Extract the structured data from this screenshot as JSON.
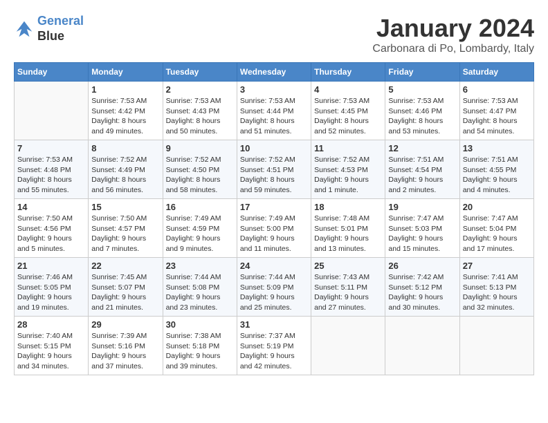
{
  "logo": {
    "line1": "General",
    "line2": "Blue"
  },
  "title": "January 2024",
  "location": "Carbonara di Po, Lombardy, Italy",
  "days_of_week": [
    "Sunday",
    "Monday",
    "Tuesday",
    "Wednesday",
    "Thursday",
    "Friday",
    "Saturday"
  ],
  "weeks": [
    [
      {
        "day": "",
        "sunrise": "",
        "sunset": "",
        "daylight": ""
      },
      {
        "day": "1",
        "sunrise": "Sunrise: 7:53 AM",
        "sunset": "Sunset: 4:42 PM",
        "daylight": "Daylight: 8 hours and 49 minutes."
      },
      {
        "day": "2",
        "sunrise": "Sunrise: 7:53 AM",
        "sunset": "Sunset: 4:43 PM",
        "daylight": "Daylight: 8 hours and 50 minutes."
      },
      {
        "day": "3",
        "sunrise": "Sunrise: 7:53 AM",
        "sunset": "Sunset: 4:44 PM",
        "daylight": "Daylight: 8 hours and 51 minutes."
      },
      {
        "day": "4",
        "sunrise": "Sunrise: 7:53 AM",
        "sunset": "Sunset: 4:45 PM",
        "daylight": "Daylight: 8 hours and 52 minutes."
      },
      {
        "day": "5",
        "sunrise": "Sunrise: 7:53 AM",
        "sunset": "Sunset: 4:46 PM",
        "daylight": "Daylight: 8 hours and 53 minutes."
      },
      {
        "day": "6",
        "sunrise": "Sunrise: 7:53 AM",
        "sunset": "Sunset: 4:47 PM",
        "daylight": "Daylight: 8 hours and 54 minutes."
      }
    ],
    [
      {
        "day": "7",
        "sunrise": "Sunrise: 7:53 AM",
        "sunset": "Sunset: 4:48 PM",
        "daylight": "Daylight: 8 hours and 55 minutes."
      },
      {
        "day": "8",
        "sunrise": "Sunrise: 7:52 AM",
        "sunset": "Sunset: 4:49 PM",
        "daylight": "Daylight: 8 hours and 56 minutes."
      },
      {
        "day": "9",
        "sunrise": "Sunrise: 7:52 AM",
        "sunset": "Sunset: 4:50 PM",
        "daylight": "Daylight: 8 hours and 58 minutes."
      },
      {
        "day": "10",
        "sunrise": "Sunrise: 7:52 AM",
        "sunset": "Sunset: 4:51 PM",
        "daylight": "Daylight: 8 hours and 59 minutes."
      },
      {
        "day": "11",
        "sunrise": "Sunrise: 7:52 AM",
        "sunset": "Sunset: 4:53 PM",
        "daylight": "Daylight: 9 hours and 1 minute."
      },
      {
        "day": "12",
        "sunrise": "Sunrise: 7:51 AM",
        "sunset": "Sunset: 4:54 PM",
        "daylight": "Daylight: 9 hours and 2 minutes."
      },
      {
        "day": "13",
        "sunrise": "Sunrise: 7:51 AM",
        "sunset": "Sunset: 4:55 PM",
        "daylight": "Daylight: 9 hours and 4 minutes."
      }
    ],
    [
      {
        "day": "14",
        "sunrise": "Sunrise: 7:50 AM",
        "sunset": "Sunset: 4:56 PM",
        "daylight": "Daylight: 9 hours and 5 minutes."
      },
      {
        "day": "15",
        "sunrise": "Sunrise: 7:50 AM",
        "sunset": "Sunset: 4:57 PM",
        "daylight": "Daylight: 9 hours and 7 minutes."
      },
      {
        "day": "16",
        "sunrise": "Sunrise: 7:49 AM",
        "sunset": "Sunset: 4:59 PM",
        "daylight": "Daylight: 9 hours and 9 minutes."
      },
      {
        "day": "17",
        "sunrise": "Sunrise: 7:49 AM",
        "sunset": "Sunset: 5:00 PM",
        "daylight": "Daylight: 9 hours and 11 minutes."
      },
      {
        "day": "18",
        "sunrise": "Sunrise: 7:48 AM",
        "sunset": "Sunset: 5:01 PM",
        "daylight": "Daylight: 9 hours and 13 minutes."
      },
      {
        "day": "19",
        "sunrise": "Sunrise: 7:47 AM",
        "sunset": "Sunset: 5:03 PM",
        "daylight": "Daylight: 9 hours and 15 minutes."
      },
      {
        "day": "20",
        "sunrise": "Sunrise: 7:47 AM",
        "sunset": "Sunset: 5:04 PM",
        "daylight": "Daylight: 9 hours and 17 minutes."
      }
    ],
    [
      {
        "day": "21",
        "sunrise": "Sunrise: 7:46 AM",
        "sunset": "Sunset: 5:05 PM",
        "daylight": "Daylight: 9 hours and 19 minutes."
      },
      {
        "day": "22",
        "sunrise": "Sunrise: 7:45 AM",
        "sunset": "Sunset: 5:07 PM",
        "daylight": "Daylight: 9 hours and 21 minutes."
      },
      {
        "day": "23",
        "sunrise": "Sunrise: 7:44 AM",
        "sunset": "Sunset: 5:08 PM",
        "daylight": "Daylight: 9 hours and 23 minutes."
      },
      {
        "day": "24",
        "sunrise": "Sunrise: 7:44 AM",
        "sunset": "Sunset: 5:09 PM",
        "daylight": "Daylight: 9 hours and 25 minutes."
      },
      {
        "day": "25",
        "sunrise": "Sunrise: 7:43 AM",
        "sunset": "Sunset: 5:11 PM",
        "daylight": "Daylight: 9 hours and 27 minutes."
      },
      {
        "day": "26",
        "sunrise": "Sunrise: 7:42 AM",
        "sunset": "Sunset: 5:12 PM",
        "daylight": "Daylight: 9 hours and 30 minutes."
      },
      {
        "day": "27",
        "sunrise": "Sunrise: 7:41 AM",
        "sunset": "Sunset: 5:13 PM",
        "daylight": "Daylight: 9 hours and 32 minutes."
      }
    ],
    [
      {
        "day": "28",
        "sunrise": "Sunrise: 7:40 AM",
        "sunset": "Sunset: 5:15 PM",
        "daylight": "Daylight: 9 hours and 34 minutes."
      },
      {
        "day": "29",
        "sunrise": "Sunrise: 7:39 AM",
        "sunset": "Sunset: 5:16 PM",
        "daylight": "Daylight: 9 hours and 37 minutes."
      },
      {
        "day": "30",
        "sunrise": "Sunrise: 7:38 AM",
        "sunset": "Sunset: 5:18 PM",
        "daylight": "Daylight: 9 hours and 39 minutes."
      },
      {
        "day": "31",
        "sunrise": "Sunrise: 7:37 AM",
        "sunset": "Sunset: 5:19 PM",
        "daylight": "Daylight: 9 hours and 42 minutes."
      },
      {
        "day": "",
        "sunrise": "",
        "sunset": "",
        "daylight": ""
      },
      {
        "day": "",
        "sunrise": "",
        "sunset": "",
        "daylight": ""
      },
      {
        "day": "",
        "sunrise": "",
        "sunset": "",
        "daylight": ""
      }
    ]
  ]
}
